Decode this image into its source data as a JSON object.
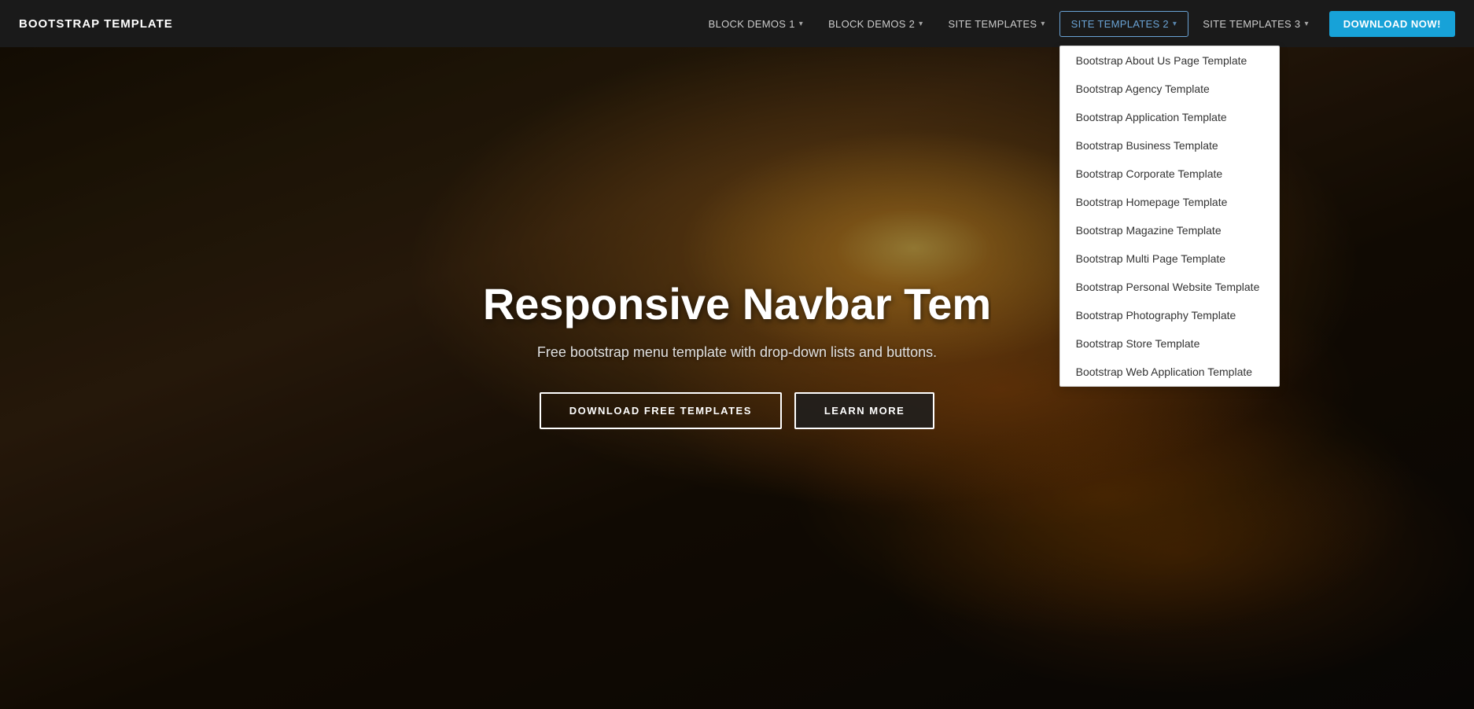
{
  "navbar": {
    "brand": "BOOTSTRAP TEMPLATE",
    "links": [
      {
        "label": "BLOCK DEMOS 1",
        "id": "block-demos-1",
        "hasDropdown": true
      },
      {
        "label": "BLOCK DEMOS 2",
        "id": "block-demos-2",
        "hasDropdown": true
      },
      {
        "label": "SITE TEMPLATES",
        "id": "site-templates",
        "hasDropdown": true
      },
      {
        "label": "SITE TEMPLATES 2",
        "id": "site-templates-2",
        "hasDropdown": true,
        "active": true
      },
      {
        "label": "SITE TEMPLATES 3",
        "id": "site-templates-3",
        "hasDropdown": true
      }
    ],
    "cta": "DOWNLOAD NOW!"
  },
  "dropdown": {
    "title": "SITE TEMPLATES 2",
    "items": [
      "Bootstrap About Us Page Template",
      "Bootstrap Agency Template",
      "Bootstrap Application Template",
      "Bootstrap Business Template",
      "Bootstrap Corporate Template",
      "Bootstrap Homepage Template",
      "Bootstrap Magazine Template",
      "Bootstrap Multi Page Template",
      "Bootstrap Personal Website Template",
      "Bootstrap Photography Template",
      "Bootstrap Store Template",
      "Bootstrap Web Application Template"
    ]
  },
  "hero": {
    "title": "Responsive Navbar Tem",
    "subtitle": "Free bootstrap menu template with drop-down lists and buttons.",
    "btn_primary": "DOWNLOAD FREE TEMPLATES",
    "btn_secondary": "LEARN MORE"
  }
}
